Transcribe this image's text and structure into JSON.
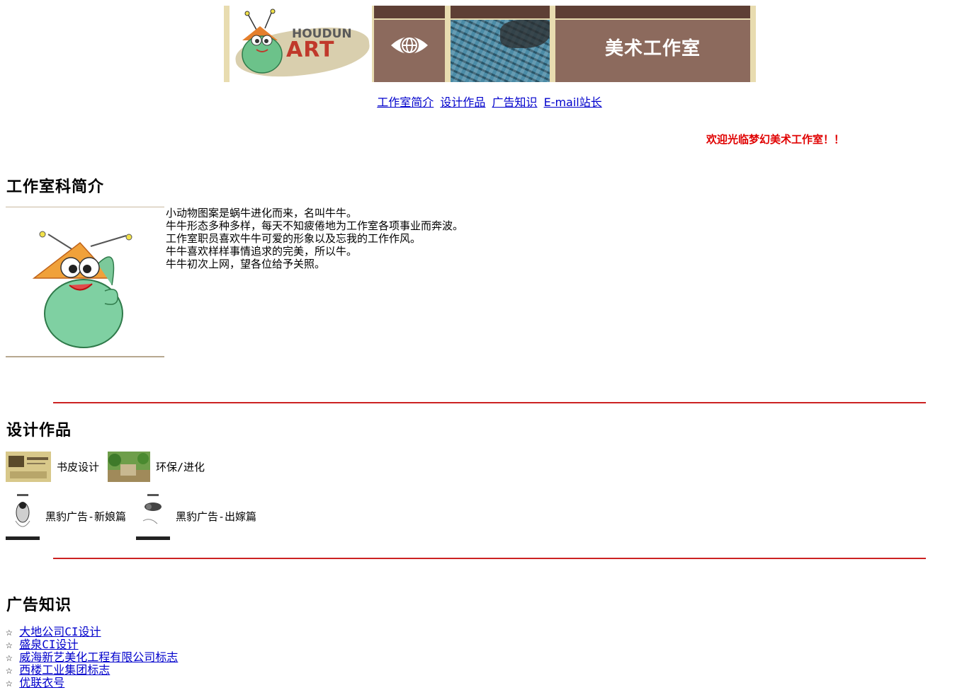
{
  "banner": {
    "logo_top_text": "HOUDUN",
    "logo_art_text": "ART",
    "title": "美术工作室",
    "colors": {
      "brown": "#8c6a5d",
      "dark_brown": "#5e3f35",
      "cream": "#e8dcb0"
    }
  },
  "nav": {
    "items": [
      {
        "label": "工作室简介"
      },
      {
        "label": "设计作品"
      },
      {
        "label": "广告知识"
      },
      {
        "label": "E-mail站长"
      }
    ]
  },
  "welcome": "欢迎光临梦幻美术工作室！！",
  "intro": {
    "heading": "工作室科简介",
    "lines": [
      "小动物图案是蜗牛进化而来，名叫牛牛。",
      "牛牛形态多种多样，每天不知疲倦地为工作室各项事业而奔波。",
      "工作室职员喜欢牛牛可爱的形象以及忘我的工作作风。",
      "牛牛喜欢样样事情追求的完美，所以牛。",
      "牛牛初次上网，望各位给予关照。"
    ]
  },
  "works": {
    "heading": "设计作品",
    "items": [
      {
        "label": "书皮设计"
      },
      {
        "label": "环保/进化"
      },
      {
        "label": "黑豹广告-新娘篇"
      },
      {
        "label": "黑豹广告-出嫁篇"
      }
    ]
  },
  "ads": {
    "heading": "广告知识",
    "star": "☆",
    "links": [
      {
        "label": "大地公司CI设计"
      },
      {
        "label": "盛泉CI设计"
      },
      {
        "label": "威海新艺美化工程有限公司标志 "
      },
      {
        "label": "西楼工业集团标志 "
      },
      {
        "label": "优联衣号"
      }
    ]
  },
  "accent_red": "#cc2222"
}
